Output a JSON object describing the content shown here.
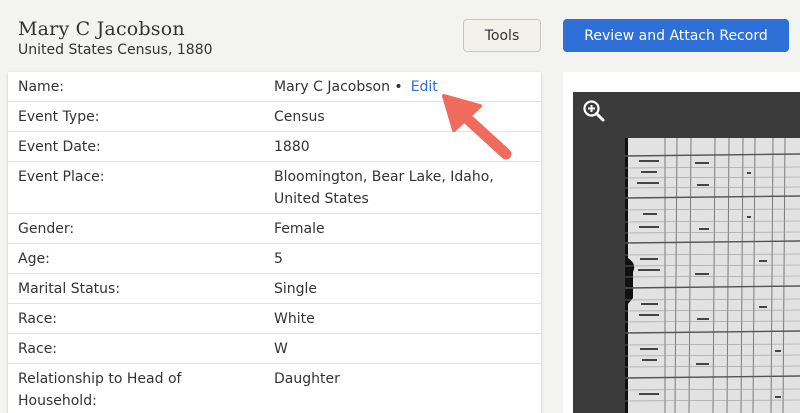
{
  "header": {
    "name": "Mary C Jacobson",
    "collection": "United States Census, 1880"
  },
  "toolbar": {
    "tools_label": "Tools",
    "attach_label": "Review and Attach Record"
  },
  "details": {
    "rows": [
      {
        "label": "Name:",
        "value": "Mary C Jacobson •",
        "link": "Edit"
      },
      {
        "label": "Event Type:",
        "value": "Census"
      },
      {
        "label": "Event Date:",
        "value": "1880"
      },
      {
        "label": "Event Place:",
        "value": "Bloomington, Bear Lake, Idaho, United States"
      },
      {
        "label": "Gender:",
        "value": "Female"
      },
      {
        "label": "Age:",
        "value": "5"
      },
      {
        "label": "Marital Status:",
        "value": "Single"
      },
      {
        "label": "Race:",
        "value": "White"
      },
      {
        "label": "Race:",
        "value": "W"
      },
      {
        "label": "Relationship to Head of Household:",
        "value": "Daughter"
      }
    ]
  },
  "icons": {
    "zoom": "zoom-in-icon",
    "arrow": "arrow-annotation-icon"
  },
  "colors": {
    "accent": "#2f6fd8",
    "arrow": "#f06b5b",
    "viewer_bg": "#3b3b3b"
  }
}
